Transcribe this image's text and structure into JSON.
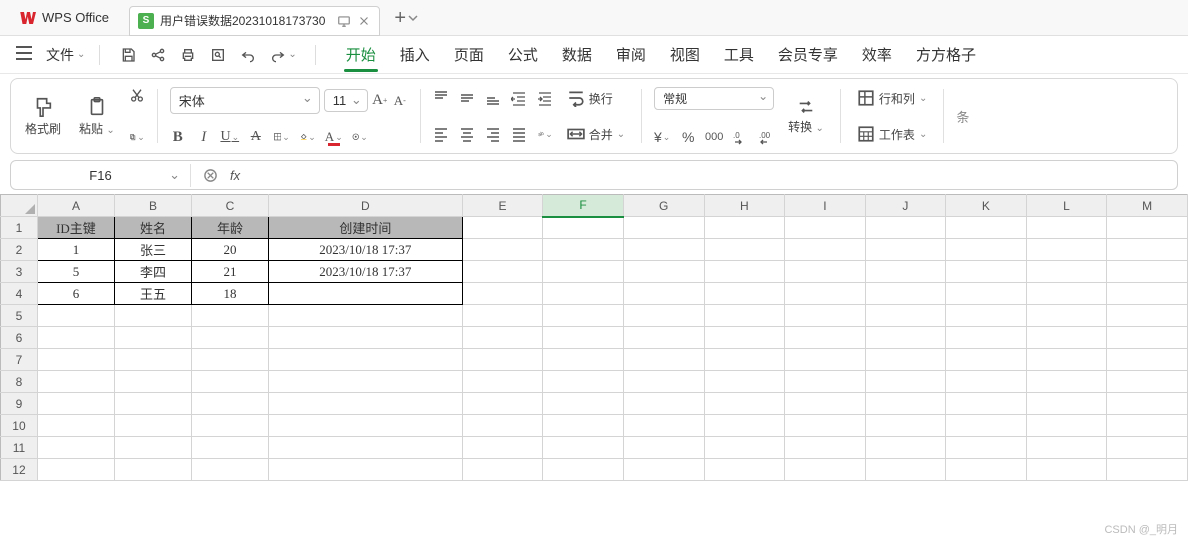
{
  "app": {
    "name": "WPS Office"
  },
  "tab": {
    "icon_letter": "S",
    "name": "用户错误数据20231018173730"
  },
  "menu": {
    "file": "文件",
    "ribbon_tabs": [
      "开始",
      "插入",
      "页面",
      "公式",
      "数据",
      "审阅",
      "视图",
      "工具",
      "会员专享",
      "效率",
      "方方格子"
    ],
    "active_tab_index": 0
  },
  "ribbon": {
    "format_painter": "格式刷",
    "paste": "粘贴",
    "font_name": "宋体",
    "font_size": "11",
    "wrap": "换行",
    "merge": "合并",
    "number_format": "常规",
    "convert": "转换",
    "rows_cols": "行和列",
    "worksheet": "工作表"
  },
  "formula_bar": {
    "cell_ref": "F16",
    "fx": "fx"
  },
  "sheet": {
    "columns": [
      "A",
      "B",
      "C",
      "D",
      "E",
      "F",
      "G",
      "H",
      "I",
      "J",
      "K",
      "L",
      "M"
    ],
    "selected_col": "F",
    "headers": [
      "ID主键",
      "姓名",
      "年龄",
      "创建时间"
    ],
    "rows": [
      {
        "id": "1",
        "name": "张三",
        "age": "20",
        "created": "2023/10/18 17:37"
      },
      {
        "id": "5",
        "name": "李四",
        "age": "21",
        "created": "2023/10/18 17:37"
      },
      {
        "id": "6",
        "name": "王五",
        "age": "18",
        "created": ""
      }
    ],
    "row_numbers": [
      "1",
      "2",
      "3",
      "4",
      "5",
      "6",
      "7",
      "8",
      "9",
      "10",
      "11",
      "12"
    ]
  },
  "watermark": "CSDN @_明月"
}
